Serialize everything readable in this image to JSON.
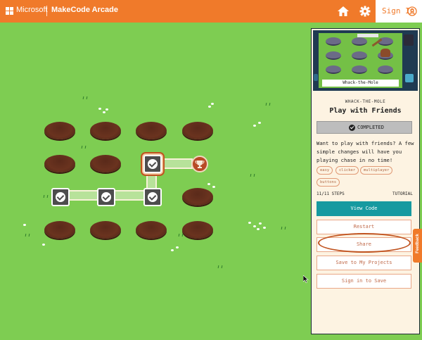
{
  "header": {
    "brand": "Microsoft",
    "app_title": "MakeCode Arcade",
    "signin_label": "Sign In",
    "icons": [
      "home-icon",
      "gear-icon",
      "user-icon"
    ],
    "colors": {
      "accent": "#f07a2a"
    }
  },
  "map": {
    "background": "#7ecd52",
    "completed_steps": 5,
    "current_step": "top-right checkpoint",
    "goal_icon": "trophy-icon"
  },
  "sidebar": {
    "thumbnail_caption": "Whack-the-Mole",
    "project_name": "WHACK-THE-MOLE",
    "tutorial_title": "Play with Friends",
    "status_label": "COMPLETED",
    "description": "Want to play with friends? A few simple changes will have you playing chase in no time!",
    "tags": [
      "easy",
      "clicker",
      "multiplayer",
      "buttons"
    ],
    "steps": "11/11 STEPS",
    "steps_type": "TUTORIAL",
    "buttons": {
      "view_code": "View Code",
      "restart": "Restart",
      "share": "Share",
      "save": "Save to My Projects",
      "signin_save": "Sign in to Save"
    },
    "colors": {
      "primary": "#169aa0",
      "outline": "#e9a787"
    }
  },
  "feedback_label": "Feedback"
}
